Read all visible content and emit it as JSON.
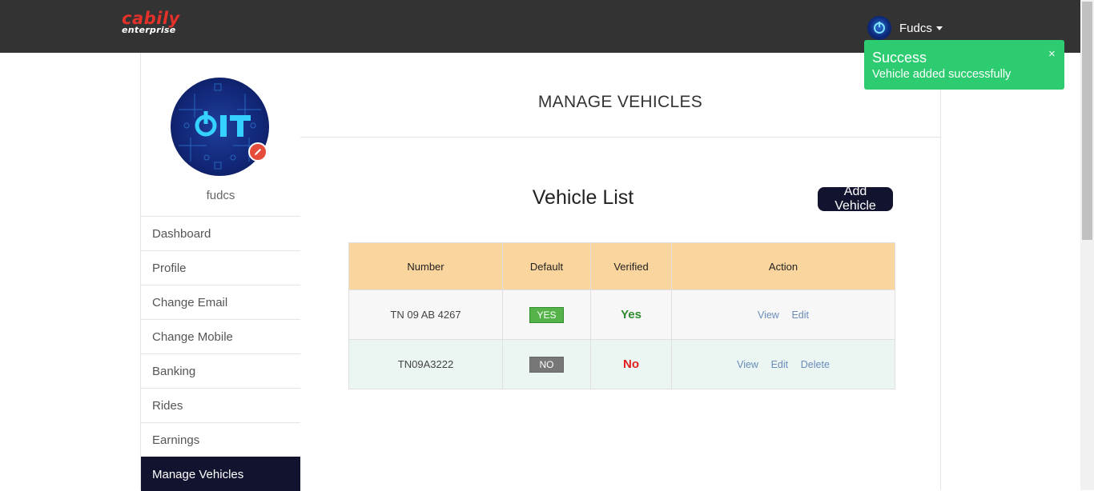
{
  "brand": {
    "name": "cabily",
    "sub": "enterprise",
    "color": "#e4322b"
  },
  "header": {
    "username": "Fudcs"
  },
  "sidebar": {
    "username": "fudcs",
    "items": [
      {
        "label": "Dashboard",
        "active": false
      },
      {
        "label": "Profile",
        "active": false
      },
      {
        "label": "Change Email",
        "active": false
      },
      {
        "label": "Change Mobile",
        "active": false
      },
      {
        "label": "Banking",
        "active": false
      },
      {
        "label": "Rides",
        "active": false
      },
      {
        "label": "Earnings",
        "active": false
      },
      {
        "label": "Manage Vehicles",
        "active": true
      }
    ]
  },
  "main": {
    "page_title": "MANAGE VEHICLES",
    "section_title": "Vehicle List",
    "add_button": "Add Vehicle",
    "table": {
      "columns": [
        "Number",
        "Default",
        "Verified",
        "Action"
      ],
      "rows": [
        {
          "number": "TN 09 AB 4267",
          "default": "YES",
          "verified": "Yes",
          "actions": [
            "View",
            "Edit"
          ]
        },
        {
          "number": "TN09A3222",
          "default": "NO",
          "verified": "No",
          "actions": [
            "View",
            "Edit",
            "Delete"
          ]
        }
      ]
    }
  },
  "toast": {
    "title": "Success",
    "message": "Vehicle added successfully",
    "close": "×",
    "color": "#2ecc71"
  }
}
